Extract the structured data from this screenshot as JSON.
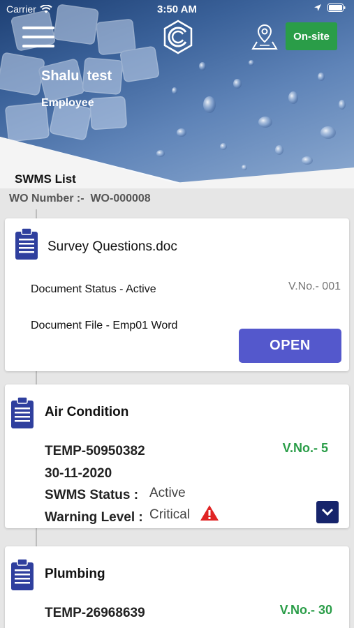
{
  "status_bar": {
    "carrier": "Carrier",
    "time": "3:50 AM"
  },
  "header": {
    "user_name": "Shalu  test",
    "user_role": "Employee",
    "onsite_label": "On-site",
    "icons": [
      "menu-icon",
      "company-logo",
      "location-pin-icon"
    ]
  },
  "list": {
    "title": "SWMS List",
    "wo_label": "WO Number :-  WO-000008"
  },
  "document_card": {
    "title": "Survey Questions.doc",
    "status": "Document Status - Active",
    "version": "V.No.- 001",
    "file": "Document File - Emp01 Word",
    "open_label": "OPEN"
  },
  "swms_cards": [
    {
      "title": "Air Condition",
      "template": "TEMP-50950382",
      "date": "30-11-2020",
      "version": "V.No.- 5",
      "status_label": "SWMS Status :",
      "status_value": "Active",
      "warning_label": "Warning Level :",
      "warning_value": "Critical"
    },
    {
      "title": "Plumbing",
      "template": "TEMP-26968639",
      "version": "V.No.- 30"
    }
  ],
  "colors": {
    "accent_button": "#5458cc",
    "onsite_green": "#2a9d48",
    "version_green": "#2a9d48",
    "clipboard_blue": "#2f3f9e",
    "expand_navy": "#16246b",
    "warning_red": "#e02424"
  }
}
